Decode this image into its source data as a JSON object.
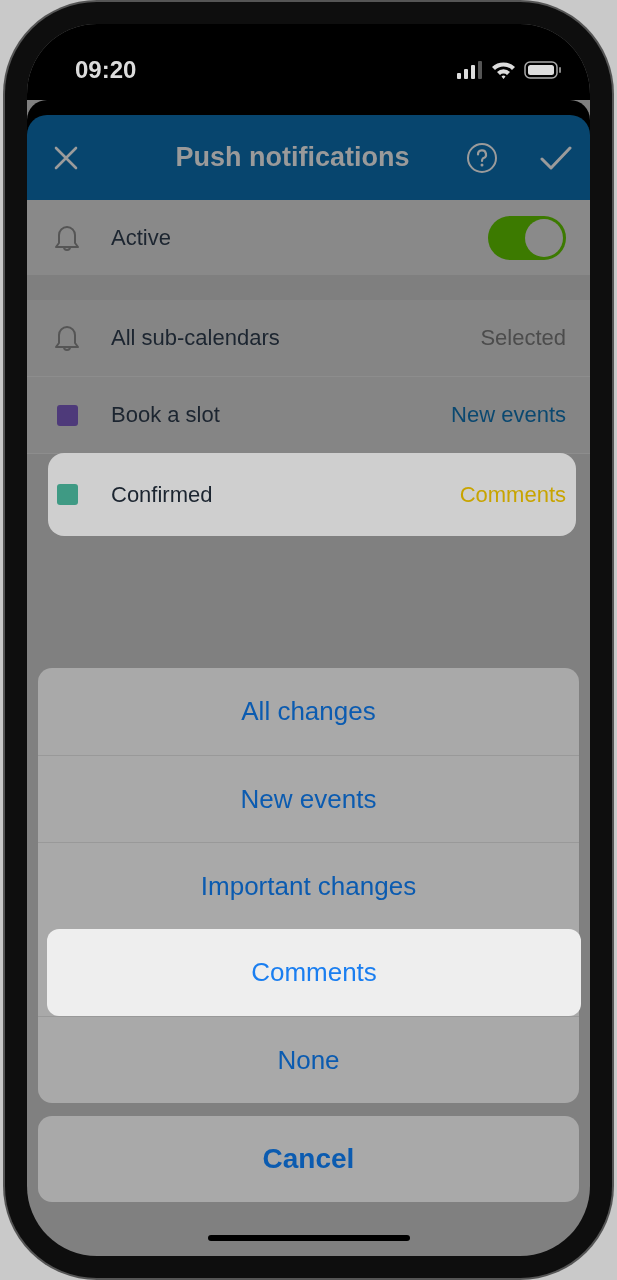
{
  "status_bar": {
    "time": "09:20"
  },
  "header": {
    "title": "Push notifications"
  },
  "active": {
    "label": "Active",
    "on": true
  },
  "calendars": [
    {
      "kind": "all",
      "name": "All sub-calendars",
      "value": "Selected",
      "highlighted": false
    },
    {
      "kind": "calendar",
      "name": "Book a slot",
      "value": "New events",
      "color": "#4e3a7a",
      "highlighted": false
    },
    {
      "kind": "calendar",
      "name": "Confirmed",
      "value": "Comments",
      "color": "#3f9a84",
      "highlighted": true
    }
  ],
  "action_sheet": {
    "options": [
      {
        "label": "All changes",
        "selected": false
      },
      {
        "label": "New events",
        "selected": false
      },
      {
        "label": "Important changes",
        "selected": false
      },
      {
        "label": "Comments",
        "selected": true
      },
      {
        "label": "None",
        "selected": false
      }
    ],
    "cancel": "Cancel"
  }
}
